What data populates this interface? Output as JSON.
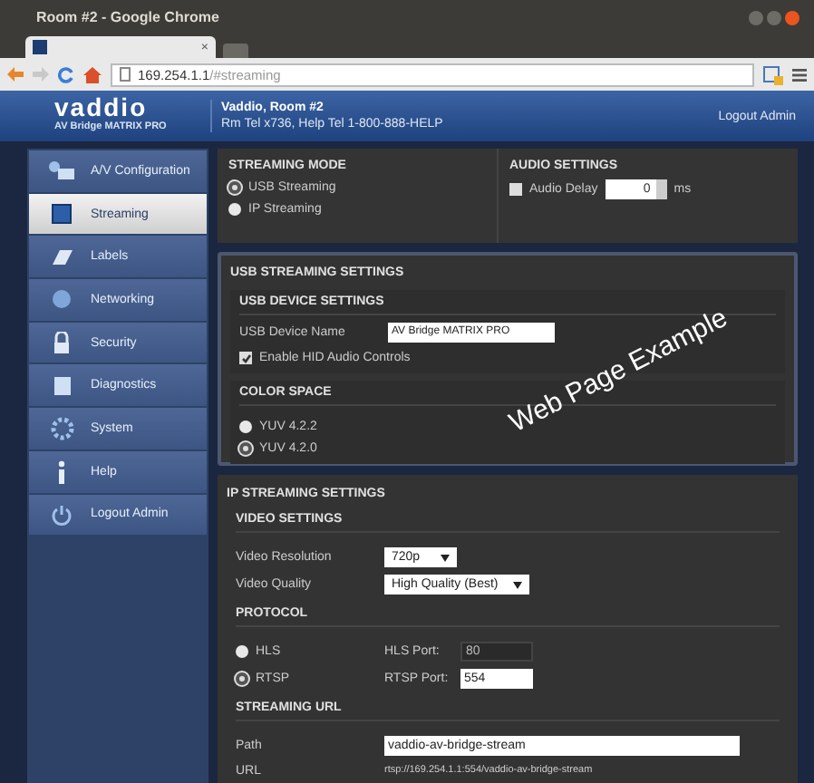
{
  "browser": {
    "window_title": "Room #2 - Google Chrome",
    "tab_close": "×",
    "url_host": "169.254.1.1",
    "url_path": "/#streaming"
  },
  "header": {
    "logo": "vaddio",
    "logo_subtitle": "AV Bridge MATRIX PRO",
    "room": "Vaddio, Room #2",
    "contact": "Rm Tel x736, Help Tel 1-800-888-HELP",
    "logout": "Logout Admin"
  },
  "sidebar": {
    "items": [
      {
        "label": "A/V Configuration",
        "selected": false
      },
      {
        "label": "Streaming",
        "selected": true
      },
      {
        "label": "Labels",
        "selected": false
      },
      {
        "label": "Networking",
        "selected": false
      },
      {
        "label": "Security",
        "selected": false
      },
      {
        "label": "Diagnostics",
        "selected": false
      },
      {
        "label": "System",
        "selected": false
      },
      {
        "label": "Help",
        "selected": false
      },
      {
        "label": "Logout Admin",
        "selected": false
      }
    ]
  },
  "streaming_mode": {
    "title": "STREAMING MODE",
    "options": [
      {
        "label": "USB Streaming",
        "selected": true
      },
      {
        "label": "IP Streaming",
        "selected": false
      }
    ]
  },
  "audio_settings": {
    "title": "AUDIO SETTINGS",
    "label": "Audio Delay",
    "checked": false,
    "value": "0",
    "unit": "ms"
  },
  "usb_streaming": {
    "title": "USB STREAMING SETTINGS",
    "device_title": "USB DEVICE SETTINGS",
    "device_name_label": "USB Device Name",
    "device_name_value": "AV Bridge MATRIX PRO",
    "hid_label": "Enable HID Audio Controls",
    "hid_checked": true,
    "color_space_title": "COLOR SPACE",
    "color_options": [
      {
        "label": "YUV 4.2.2",
        "selected": false
      },
      {
        "label": "YUV 4.2.0",
        "selected": true
      }
    ]
  },
  "ip_streaming": {
    "title": "IP STREAMING SETTINGS",
    "video_title": "VIDEO SETTINGS",
    "video_rows": [
      {
        "label": "Video Resolution",
        "value": "720p"
      },
      {
        "label": "Video Quality",
        "value": "High Quality (Best)"
      }
    ],
    "protocol_title": "PROTOCOL",
    "protocols": [
      {
        "label": "HLS",
        "selected": false,
        "port_label": "HLS Port:",
        "port_value": "80"
      },
      {
        "label": "RTSP",
        "selected": true,
        "port_label": "RTSP Port:",
        "port_value": "554"
      }
    ],
    "url_title": "STREAMING URL",
    "path_label": "Path",
    "path_value": "vaddio-av-bridge-stream",
    "url_label": "URL",
    "url_value": "rtsp://169.254.1.1:554/vaddio-av-bridge-stream"
  },
  "annotation": "Web Page Example"
}
